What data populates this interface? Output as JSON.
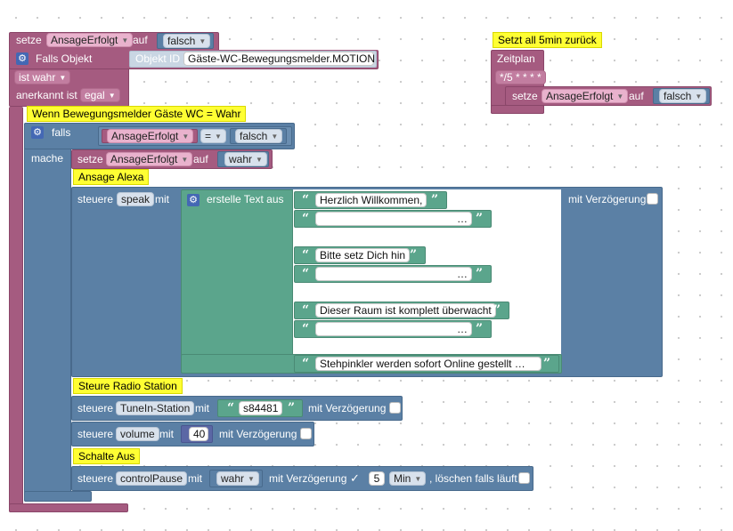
{
  "trigger": {
    "setze_label": "setze",
    "var_name": "AnsageErfolgt",
    "auf_label": "auf",
    "value": "falsch",
    "falls_objekt_label": "Falls Objekt",
    "objekt_id_label": "Objekt ID",
    "objekt_id_value": "Gäste-WC-Bewegungsmelder.MOTION",
    "ist_label": "ist wahr",
    "anerkannt_label": "anerkannt ist",
    "anerkannt_value": "egal"
  },
  "comments": {
    "motion": "Wenn Bewegungsmelder Gäste WC = Wahr",
    "alexa": "Ansage Alexa",
    "radio": "Steure Radio Station",
    "pause": "Schalte Aus",
    "schedule": "Setzt all 5min zurück"
  },
  "if_block": {
    "falls_label": "falls",
    "var_name": "AnsageErfolgt",
    "operator": "=",
    "compare_value": "falsch",
    "mache_label": "mache",
    "set_label": "setze",
    "set_var": "AnsageErfolgt",
    "set_auf": "auf",
    "set_value": "wahr"
  },
  "speak": {
    "steuere_label": "steuere",
    "target": "speak",
    "mit_label": "mit",
    "create_text_label": "erstelle Text aus",
    "delay_label": "mit Verzögerung",
    "texts": [
      "Herzlich Willkommen,",
      "…",
      "Bitte setz Dich hin",
      "…",
      "Dieser Raum ist komplett überwacht",
      "…",
      "Stehpinkler werden sofort Online gestellt    …"
    ]
  },
  "radio": {
    "steuere_label": "steuere",
    "target": "TuneIn-Station",
    "mit_label": "mit",
    "value": "s84481",
    "delay_label": "mit Verzögerung"
  },
  "volume": {
    "steuere_label": "steuere",
    "target": "volume",
    "mit_label": "mit",
    "value": "40",
    "delay_label": "mit Verzögerung"
  },
  "pause": {
    "steuere_label": "steuere",
    "target": "controlPause",
    "mit_label": "mit",
    "value": "wahr",
    "delay_label": "mit Verzögerung",
    "checkmark": "✓",
    "delay_amount": "5",
    "delay_unit": "Min",
    "clear_label": ", löschen falls läuft"
  },
  "schedule": {
    "zeitplan_label": "Zeitplan",
    "cron": "*/5 * * * *",
    "set_label": "setze",
    "var_name": "AnsageErfolgt",
    "auf_label": "auf",
    "value": "falsch"
  },
  "icons": {
    "gear": "⚙",
    "quote_open": "“",
    "quote_close": "”",
    "caret": "▼"
  }
}
